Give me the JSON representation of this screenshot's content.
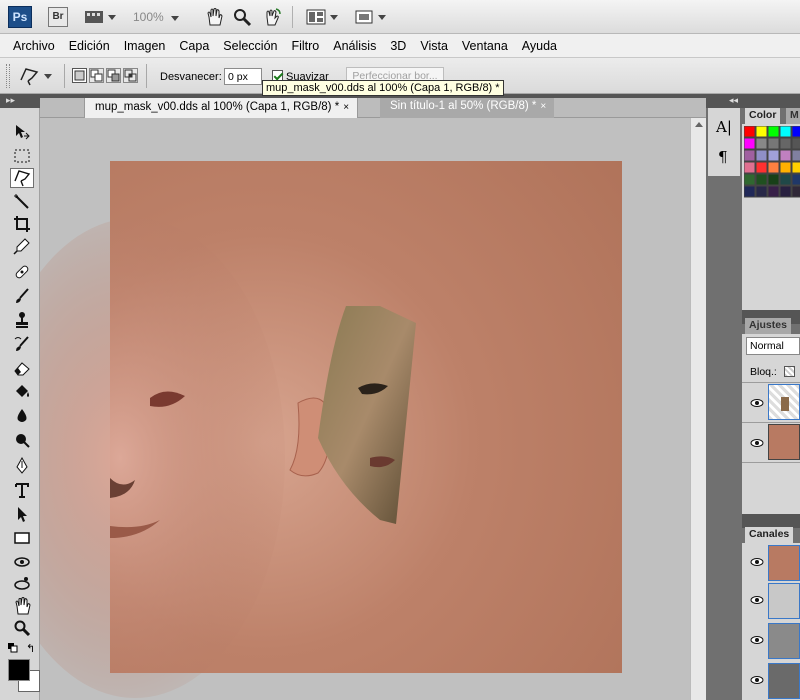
{
  "app": {
    "logo": "Ps",
    "bridge": "Br",
    "zoom": "100%"
  },
  "menu": [
    "Archivo",
    "Edición",
    "Imagen",
    "Capa",
    "Selección",
    "Filtro",
    "Análisis",
    "3D",
    "Vista",
    "Ventana",
    "Ayuda"
  ],
  "options": {
    "feather_label": "Desvanecer:",
    "feather_value": "0 px",
    "antialias_label": "Suavizar",
    "antialias_checked": true,
    "refine_label": "Perfeccionar bor..."
  },
  "tooltip": "mup_mask_v00.dds al 100% (Capa 1, RGB/8) *",
  "tabs": [
    {
      "label": "mup_mask_v00.dds al 100% (Capa 1, RGB/8) *",
      "close": "×",
      "active": true
    },
    {
      "label": "Sin título-1 al 50% (RGB/8) *",
      "close": "×",
      "active": false
    }
  ],
  "panels": {
    "color_tab": "Color",
    "other_tab": "M",
    "ajustes_tab": "Ajustes",
    "blend_mode": "Normal",
    "lock_label": "Bloq.:",
    "canales_tab": "Canales"
  },
  "side_glyphs": {
    "char": "A|",
    "para": "¶"
  },
  "colors": {
    "skin_base": "#b77a62",
    "skin_light": "#c99380",
    "ui_gray": "#d6d6d6",
    "dark_panel": "#707070"
  }
}
